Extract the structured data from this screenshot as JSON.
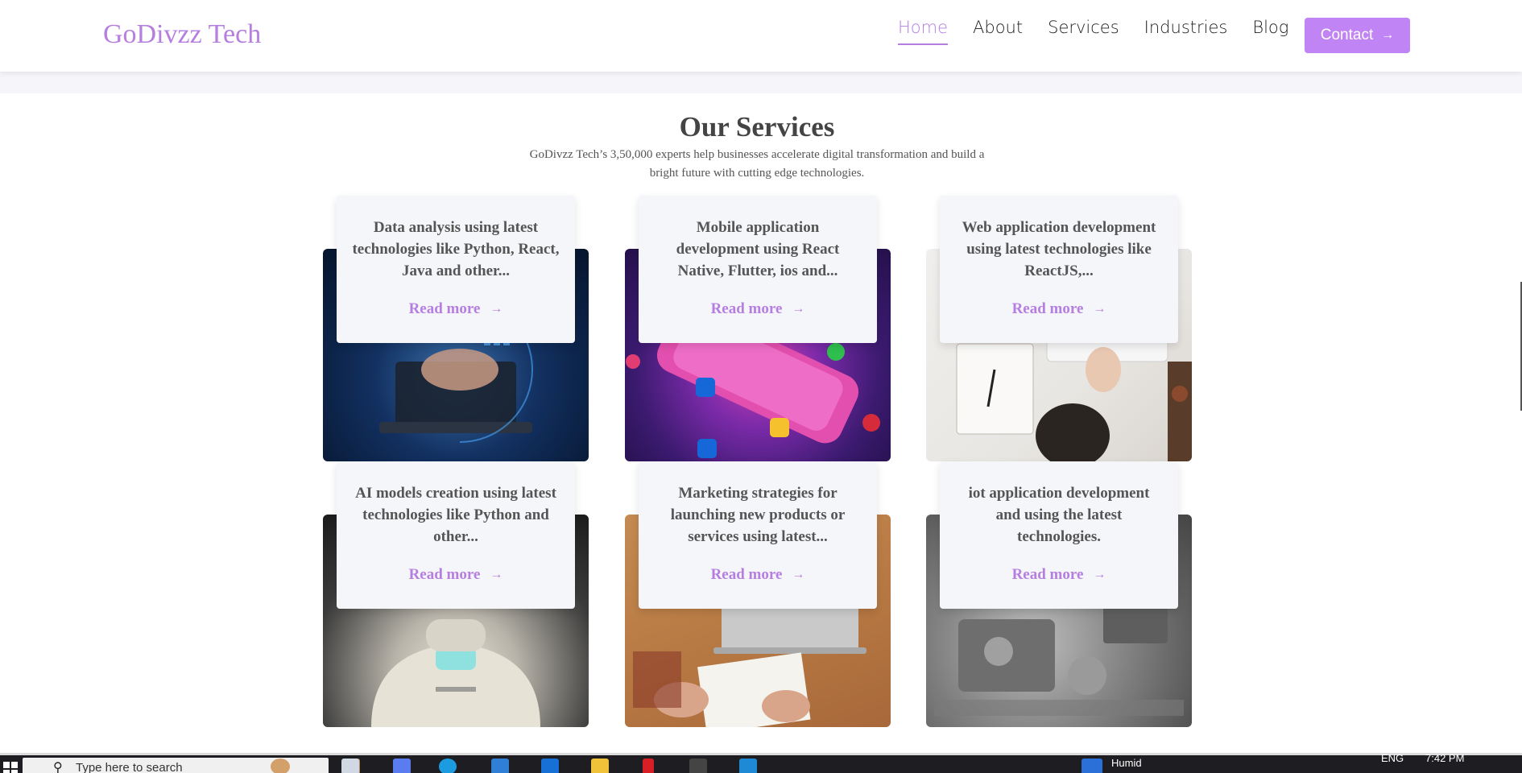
{
  "header": {
    "logo": "GoDivzz Tech",
    "nav": [
      {
        "label": "Home",
        "active": true
      },
      {
        "label": "About",
        "active": false
      },
      {
        "label": "Services",
        "active": false
      },
      {
        "label": "Industries",
        "active": false
      },
      {
        "label": "Blog",
        "active": false
      }
    ],
    "contact_label": "Contact",
    "contact_arrow": "→"
  },
  "section": {
    "title": "Our Services",
    "subtitle": "GoDivzz Tech’s 3,50,000 experts help businesses accelerate digital transformation and build a bright future with cutting edge technologies."
  },
  "services": [
    {
      "text": "Data analysis using latest technologies like Python, React, Java and other...",
      "read_more": "Read more",
      "arrow": "→",
      "image": "data-analysis-image"
    },
    {
      "text": "Mobile application development using React Native, Flutter, ios and...",
      "read_more": "Read more",
      "arrow": "→",
      "image": "mobile-app-image"
    },
    {
      "text": "Web application development using latest technologies like ReactJS,...",
      "read_more": "Read more",
      "arrow": "→",
      "image": "web-app-image"
    },
    {
      "text": "AI models creation using latest technologies like Python and other...",
      "read_more": "Read more",
      "arrow": "→",
      "image": "ai-robot-image"
    },
    {
      "text": "Marketing strategies for launching new products or services using latest...",
      "read_more": "Read more",
      "arrow": "→",
      "image": "marketing-image"
    },
    {
      "text": "iot application development and using the latest technologies.",
      "read_more": "Read more",
      "arrow": "→",
      "image": "iot-circuit-image"
    }
  ],
  "taskbar": {
    "search_placeholder": "Type here to search",
    "weather": "Humid",
    "language": "ENG",
    "time": "7:42 PM"
  },
  "colors": {
    "accent": "#b57ee0",
    "button": "#c084f5",
    "card_bg": "#f5f6fa",
    "taskbar": "#1e1e22"
  }
}
